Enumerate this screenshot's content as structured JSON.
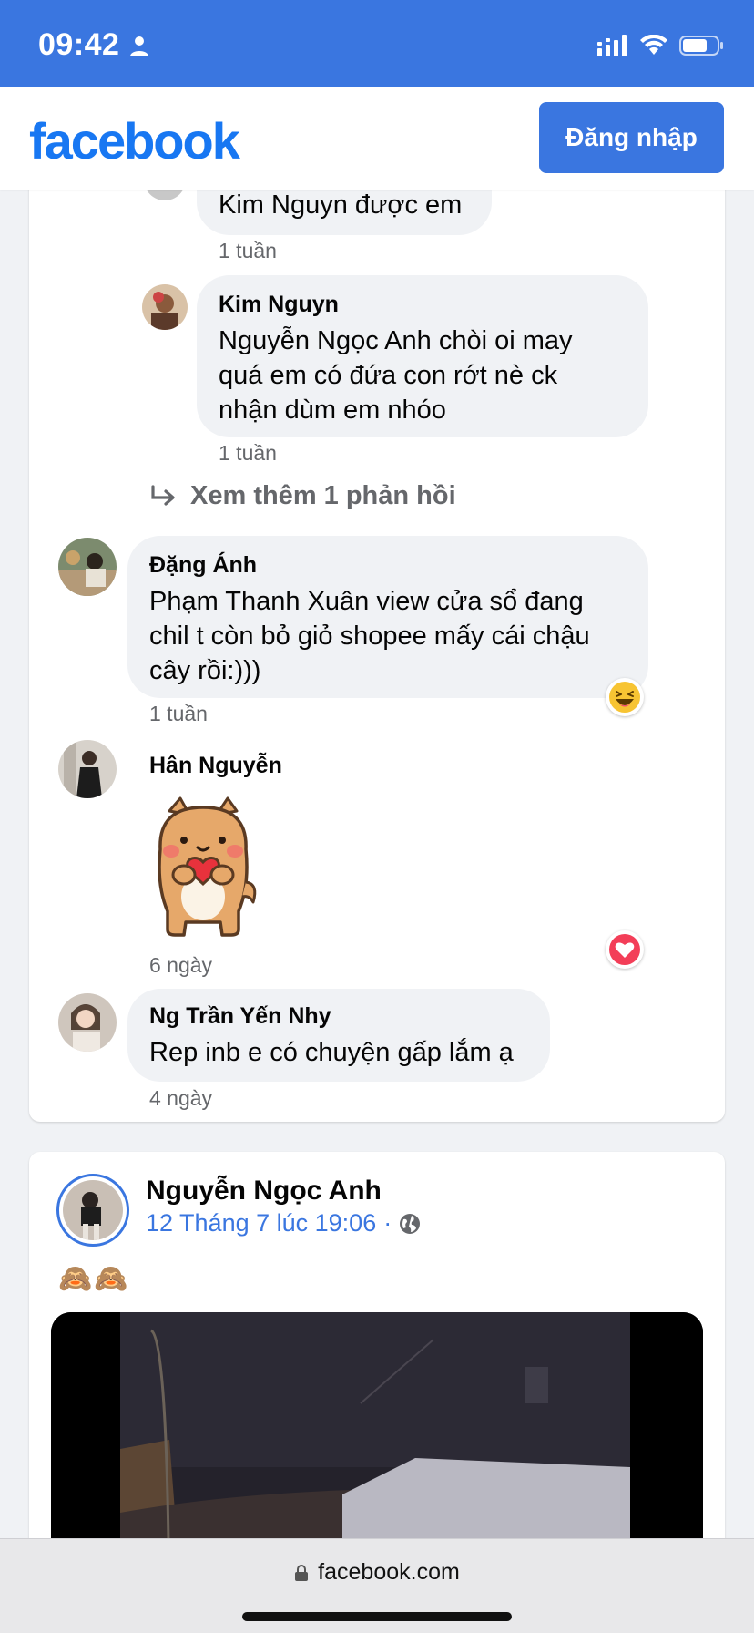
{
  "status_bar": {
    "time": "09:42"
  },
  "header": {
    "logo": "facebook",
    "login_label": "Đăng nhập"
  },
  "comments": [
    {
      "name": "",
      "text": "Kim Nguyn được em",
      "time": "1 tuần"
    },
    {
      "name": "Kim Nguyn",
      "lines": [
        "Nguyễn Ngọc Anh chòi oi may",
        "quá em có đứa con rớt nè ck",
        "nhận dùm em nhóo"
      ],
      "time": "1 tuần"
    },
    {
      "name": "Đặng Ánh",
      "lines": [
        "Phạm Thanh Xuân view cửa sổ đang",
        "chil t còn bỏ giỏ shopee mấy cái chậu",
        "cây rồi:)))"
      ],
      "time": "1 tuần",
      "reaction": "haha-icon"
    },
    {
      "name": "Hân Nguyễn",
      "sticker": "shiba-heart-sticker",
      "time": "6 ngày",
      "reaction": "love-icon"
    },
    {
      "name": "Ng Trần Yến Nhy",
      "text": "Rep inb e có chuyện gấp lắm ạ",
      "time": "4 ngày"
    }
  ],
  "more_replies": "Xem thêm 1 phản hồi",
  "post": {
    "author": "Nguyễn Ngọc Anh",
    "timestamp": "12 Tháng 7 lúc 19:06",
    "separator": "·",
    "privacy_icon": "globe-icon",
    "emoji": "🙈🙈"
  },
  "browser": {
    "url": "facebook.com"
  },
  "colors": {
    "accent": "#3a76e0",
    "fb_blue": "#1877f2",
    "bubble": "#f0f2f5",
    "meta_gray": "#65676b"
  }
}
